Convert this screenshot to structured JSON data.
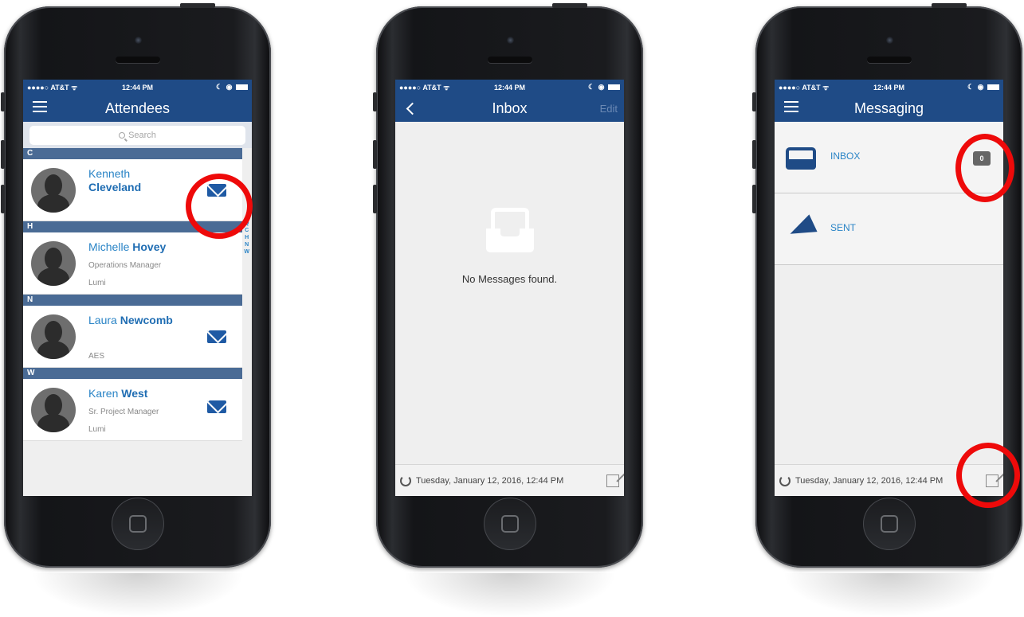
{
  "status": {
    "carrier": "●●●●○ AT&T ᯤ",
    "time": "12:44 PM",
    "right": "☾ ◉"
  },
  "attendees": {
    "title": "Attendees",
    "search_placeholder": "Search",
    "index_letters": [
      "Q",
      "C",
      "H",
      "N",
      "W"
    ],
    "sections": [
      {
        "letter": "C",
        "first": "Kenneth",
        "last": "Cleveland",
        "line1": "",
        "line2": "",
        "has_mail": true
      },
      {
        "letter": "H",
        "first": "Michelle",
        "last": "Hovey",
        "line1": "Operations Manager",
        "line2": "Lumi",
        "has_mail": false
      },
      {
        "letter": "N",
        "first": "Laura",
        "last": "Newcomb",
        "line1": "",
        "line2": "AES",
        "has_mail": true
      },
      {
        "letter": "W",
        "first": "Karen",
        "last": "West",
        "line1": "Sr. Project Manager",
        "line2": "Lumi",
        "has_mail": true
      }
    ]
  },
  "inbox": {
    "title": "Inbox",
    "edit_label": "Edit",
    "empty_message": "No Messages found.",
    "footer_timestamp": "Tuesday, January 12, 2016, 12:44 PM"
  },
  "messaging": {
    "title": "Messaging",
    "inbox_label": "INBOX",
    "inbox_count": "0",
    "sent_label": "SENT",
    "footer_timestamp": "Tuesday, January 12, 2016, 12:44 PM"
  },
  "colors": {
    "navbar": "#1f4b86",
    "accent": "#2a84c6",
    "highlight_ring": "#ee0a0a"
  }
}
